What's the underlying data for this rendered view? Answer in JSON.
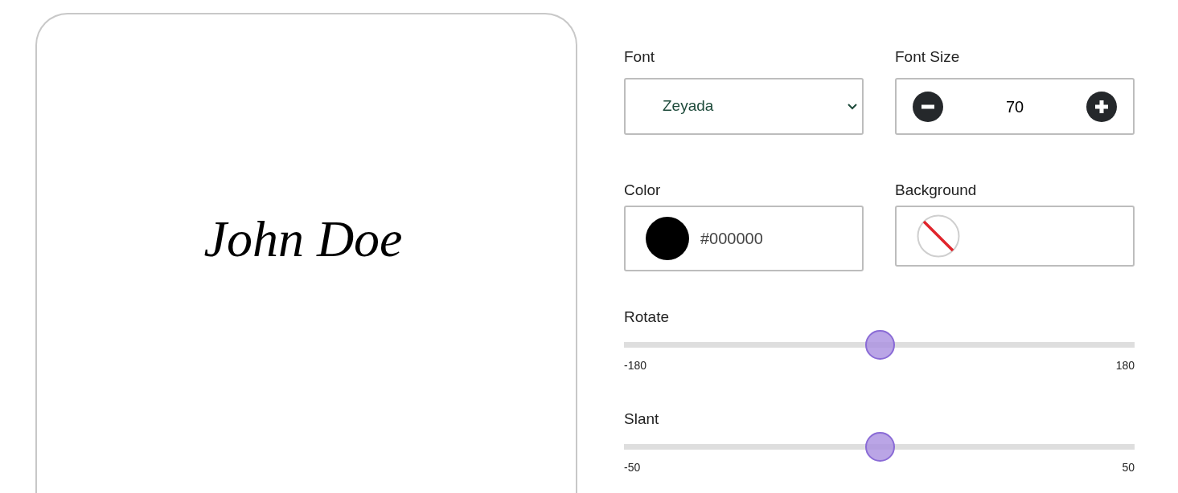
{
  "preview": {
    "signature": "John Doe"
  },
  "font": {
    "label": "Font",
    "value": "Zeyada"
  },
  "font_size": {
    "label": "Font Size",
    "value": "70"
  },
  "color": {
    "label": "Color",
    "value": "#000000",
    "color": "#000000"
  },
  "background": {
    "label": "Background",
    "transparent": true
  },
  "sliders": [
    {
      "label": "Rotate",
      "level": 0.5,
      "min": "-180",
      "max": "180"
    },
    {
      "label": "Slant",
      "level": 0.5,
      "min": "-50",
      "max": "50"
    }
  ]
}
